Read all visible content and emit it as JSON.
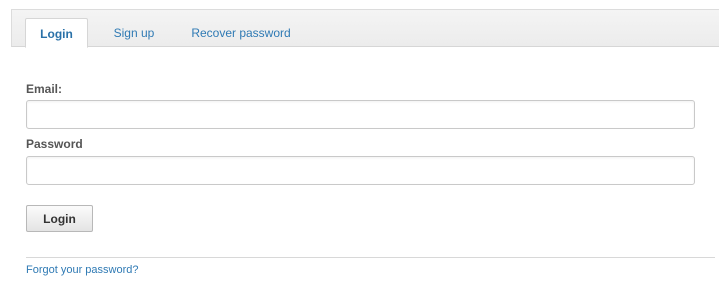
{
  "tabs": {
    "login": "Login",
    "signup": "Sign up",
    "recover": "Recover password"
  },
  "form": {
    "email_label": "Email:",
    "email_value": "",
    "password_label": "Password",
    "password_value": "",
    "submit_label": "Login"
  },
  "footer": {
    "forgot_link": "Forgot your password?"
  },
  "colors": {
    "link": "#2f7ab4",
    "active_tab_text": "#2a71a8"
  }
}
